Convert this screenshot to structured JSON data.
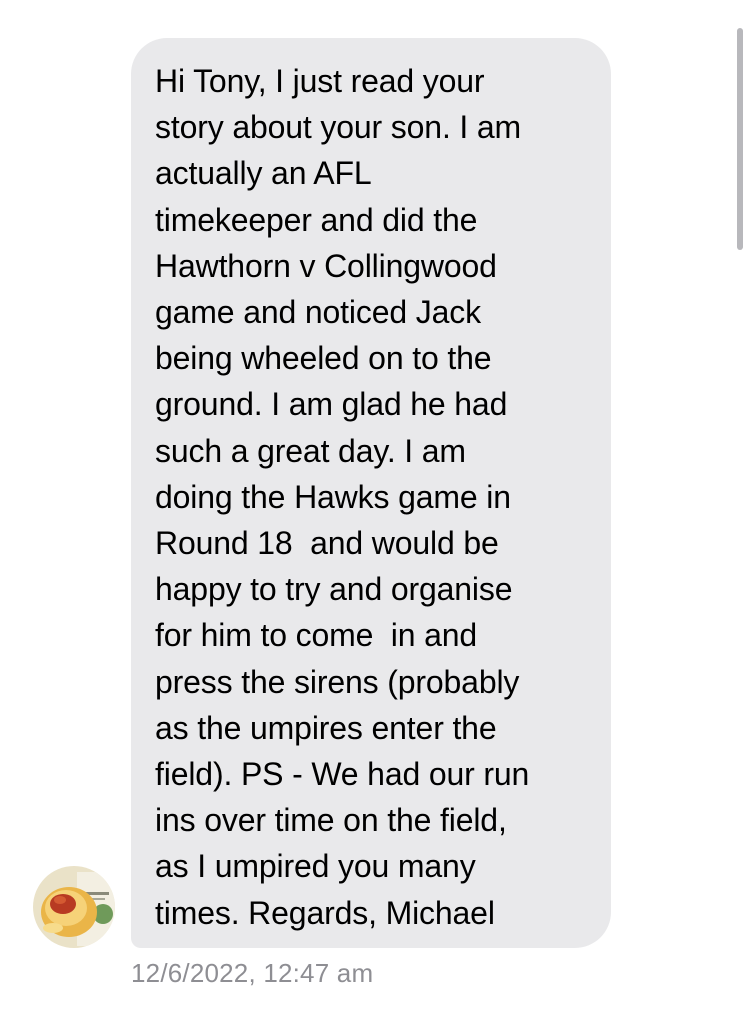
{
  "message": {
    "lines": [
      "Hi Tony, I just read your",
      "story about your son. I am",
      "actually an AFL",
      "timekeeper and did the",
      "Hawthorn v Collingwood",
      "game and noticed Jack",
      "being wheeled on to the",
      "ground. I am glad he had",
      "such a great day. I am",
      "doing the Hawks game in",
      "Round 18  and would be",
      "happy to try and organise",
      "for him to come  in and",
      "press the sirens (probably",
      "as the umpires enter the",
      "field). PS - We had our run",
      "ins over time on the field,",
      "as I umpired you many",
      "times. Regards, Michael"
    ],
    "timestamp": "12/6/2022, 12:47 am",
    "bubble_color": "#e9e9eb",
    "timestamp_color": "#8e8e93"
  },
  "sender": {
    "avatar_icon": "sender-avatar-photo"
  }
}
